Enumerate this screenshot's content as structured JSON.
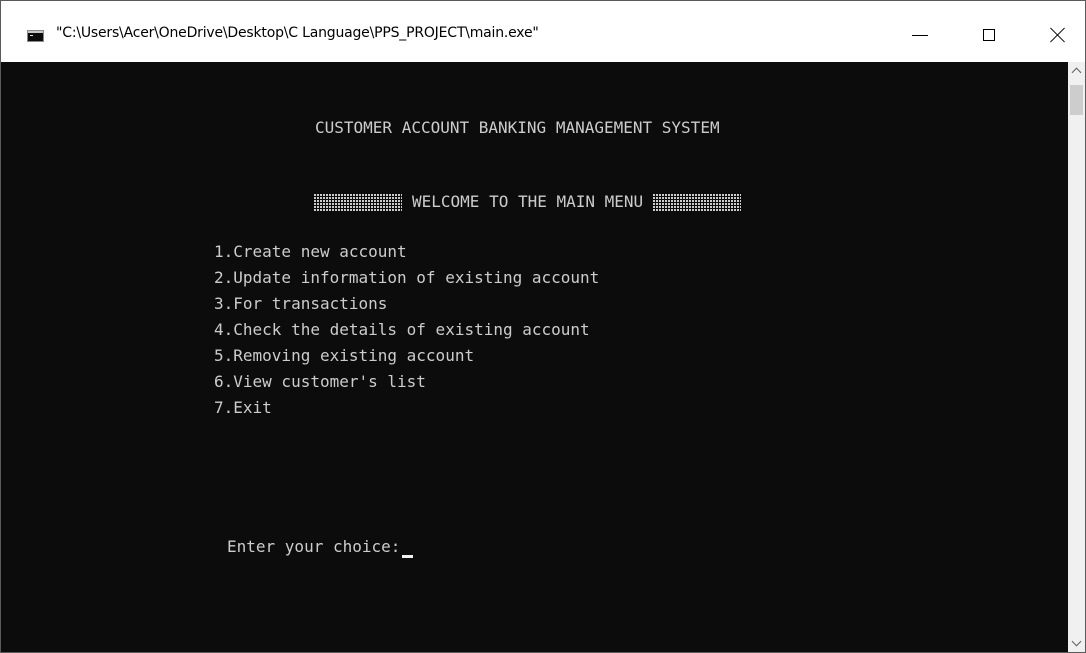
{
  "window": {
    "title": "\"C:\\Users\\Acer\\OneDrive\\Desktop\\C Language\\PPS_PROJECT\\main.exe\""
  },
  "controls": {
    "minimize_icon": "minimize-icon",
    "maximize_icon": "maximize-icon",
    "close_icon": "close-icon"
  },
  "console": {
    "heading": "CUSTOMER ACCOUNT BANKING MANAGEMENT SYSTEM",
    "welcome": "WELCOME TO THE MAIN MENU",
    "menu_items": [
      "1.Create new account",
      "2.Update information of existing account",
      "3.For transactions",
      "4.Check the details of existing account",
      "5.Removing existing account",
      "6.View customer's list",
      "7.Exit"
    ],
    "prompt": "Enter your choice:"
  },
  "colors": {
    "console_bg": "#0c0c0c",
    "console_text": "#cccccc",
    "titlebar_bg": "#ffffff",
    "scrollbar_bg": "#f0f0f0"
  }
}
